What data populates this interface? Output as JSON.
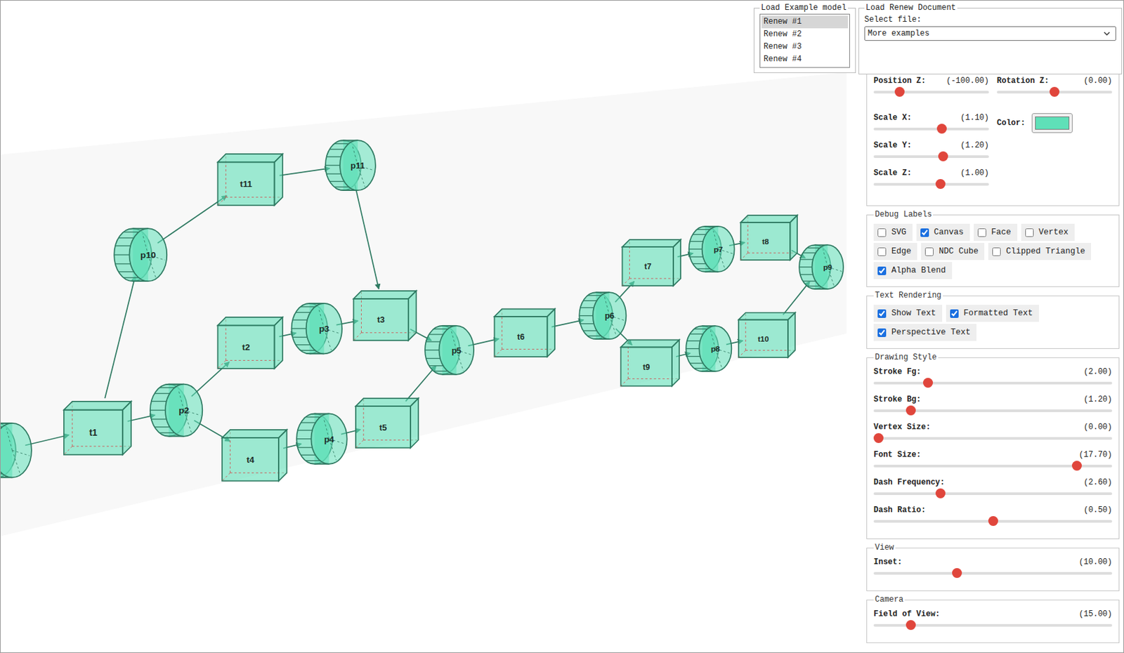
{
  "example_models": {
    "legend": "Load Example model",
    "items": [
      {
        "label": "Renew #1",
        "selected": true
      },
      {
        "label": "Renew #2",
        "selected": false
      },
      {
        "label": "Renew #3",
        "selected": false
      },
      {
        "label": "Renew #4",
        "selected": false
      }
    ]
  },
  "document": {
    "legend": "Load Renew Document",
    "label": "Select file:",
    "value": "More examples"
  },
  "transform": {
    "left": [
      {
        "label": "Position Z:",
        "reading": "(-100.00)",
        "level": 0.2
      },
      {
        "label": "Scale X:",
        "reading": "(1.10)",
        "level": 0.6
      },
      {
        "label": "Scale Y:",
        "reading": "(1.20)",
        "level": 0.61
      },
      {
        "label": "Scale Z:",
        "reading": "(1.00)",
        "level": 0.585
      }
    ],
    "right": [
      {
        "label": "Rotation Z:",
        "reading": "(0.00)",
        "level": 0.5
      }
    ],
    "color": {
      "label": "Color:",
      "value": "#5fe0b8"
    }
  },
  "debug_labels": {
    "legend": "Debug Labels",
    "rows": [
      [
        {
          "label": "SVG",
          "checked": false
        },
        {
          "label": "Canvas",
          "checked": true
        },
        {
          "label": "Face",
          "checked": false
        },
        {
          "label": "Vertex",
          "checked": false
        }
      ],
      [
        {
          "label": "Edge",
          "checked": false
        },
        {
          "label": "NDC Cube",
          "checked": false
        },
        {
          "label": "Clipped Triangle",
          "checked": false
        }
      ],
      [
        {
          "label": "Alpha Blend",
          "checked": true
        }
      ]
    ]
  },
  "text_rendering": {
    "legend": "Text Rendering",
    "rows": [
      [
        {
          "label": "Show Text",
          "checked": true
        },
        {
          "label": "Formatted Text",
          "checked": true
        }
      ],
      [
        {
          "label": "Perspective Text",
          "checked": true
        }
      ]
    ]
  },
  "drawing_style": {
    "legend": "Drawing Style",
    "sliders": [
      {
        "label": "Stroke Fg:",
        "reading": "(2.00)",
        "level": 0.216
      },
      {
        "label": "Stroke Bg:",
        "reading": "(1.20)",
        "level": 0.142
      },
      {
        "label": "Vertex Size:",
        "reading": "(0.00)",
        "level": 0.0
      },
      {
        "label": "Font Size:",
        "reading": "(17.70)",
        "level": 0.867
      },
      {
        "label": "Dash Frequency:",
        "reading": "(2.60)",
        "level": 0.27
      },
      {
        "label": "Dash Ratio:",
        "reading": "(0.50)",
        "level": 0.5
      }
    ]
  },
  "view": {
    "legend": "View",
    "sliders": [
      {
        "label": "Inset:",
        "reading": "(10.00)",
        "level": 0.343
      }
    ]
  },
  "camera": {
    "legend": "Camera",
    "sliders": [
      {
        "label": "Field of View:",
        "reading": "(15.00)",
        "level": 0.14
      }
    ]
  },
  "diagram": {
    "nodes": [
      {
        "label": "",
        "kind": "place"
      },
      {
        "label": "t1",
        "kind": "transition"
      },
      {
        "label": "p2",
        "kind": "place"
      },
      {
        "label": "p10",
        "kind": "place"
      },
      {
        "label": "t11",
        "kind": "transition"
      },
      {
        "label": "p11",
        "kind": "place"
      },
      {
        "label": "t2",
        "kind": "transition"
      },
      {
        "label": "p3",
        "kind": "place"
      },
      {
        "label": "t3",
        "kind": "transition"
      },
      {
        "label": "t4",
        "kind": "transition"
      },
      {
        "label": "p4",
        "kind": "place"
      },
      {
        "label": "t5",
        "kind": "transition"
      },
      {
        "label": "p5",
        "kind": "place"
      },
      {
        "label": "t6",
        "kind": "transition"
      },
      {
        "label": "p6",
        "kind": "place"
      },
      {
        "label": "t7",
        "kind": "transition"
      },
      {
        "label": "p7",
        "kind": "place"
      },
      {
        "label": "t8",
        "kind": "transition"
      },
      {
        "label": "p9",
        "kind": "place"
      },
      {
        "label": "t9",
        "kind": "transition"
      },
      {
        "label": "p8",
        "kind": "place"
      },
      {
        "label": "t10",
        "kind": "transition"
      }
    ],
    "arcs": [
      [
        0,
        1
      ],
      [
        1,
        2
      ],
      [
        1,
        3
      ],
      [
        3,
        4
      ],
      [
        4,
        5
      ],
      [
        5,
        8
      ],
      [
        2,
        6
      ],
      [
        6,
        7
      ],
      [
        7,
        8
      ],
      [
        8,
        12
      ],
      [
        2,
        9
      ],
      [
        9,
        10
      ],
      [
        10,
        11
      ],
      [
        11,
        12
      ],
      [
        12,
        13
      ],
      [
        13,
        14
      ],
      [
        14,
        15
      ],
      [
        15,
        16
      ],
      [
        16,
        17
      ],
      [
        17,
        18
      ],
      [
        14,
        19
      ],
      [
        19,
        20
      ],
      [
        20,
        21
      ],
      [
        21,
        18
      ]
    ]
  }
}
